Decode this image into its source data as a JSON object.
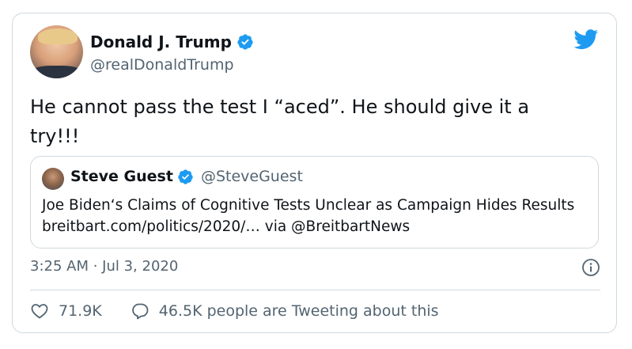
{
  "author": {
    "display_name": "Donald J. Trump",
    "handle": "@realDonaldTrump"
  },
  "tweet": {
    "text": "He cannot pass the test I “aced”. He should give it a try!!!"
  },
  "quoted_tweet": {
    "display_name": "Steve Guest",
    "handle": "@SteveGuest",
    "text": "Joe Biden‘s Claims of Cognitive Tests Unclear as Campaign Hides Results breitbart.com/politics/2020/… via @BreitbartNews"
  },
  "meta": {
    "timestamp": "3:25 AM · Jul 3, 2020"
  },
  "actions": {
    "likes": "71.9K",
    "conversation": "46.5K people are Tweeting about this"
  },
  "colors": {
    "accent": "#1d9bf0",
    "text": "#0f1419",
    "muted": "#536471",
    "border": "#cfd9de"
  },
  "icons": {
    "brand": "twitter-bird-icon",
    "verified": "verified-badge-icon",
    "info": "info-icon",
    "like": "heart-icon",
    "reply": "speech-bubble-icon"
  }
}
